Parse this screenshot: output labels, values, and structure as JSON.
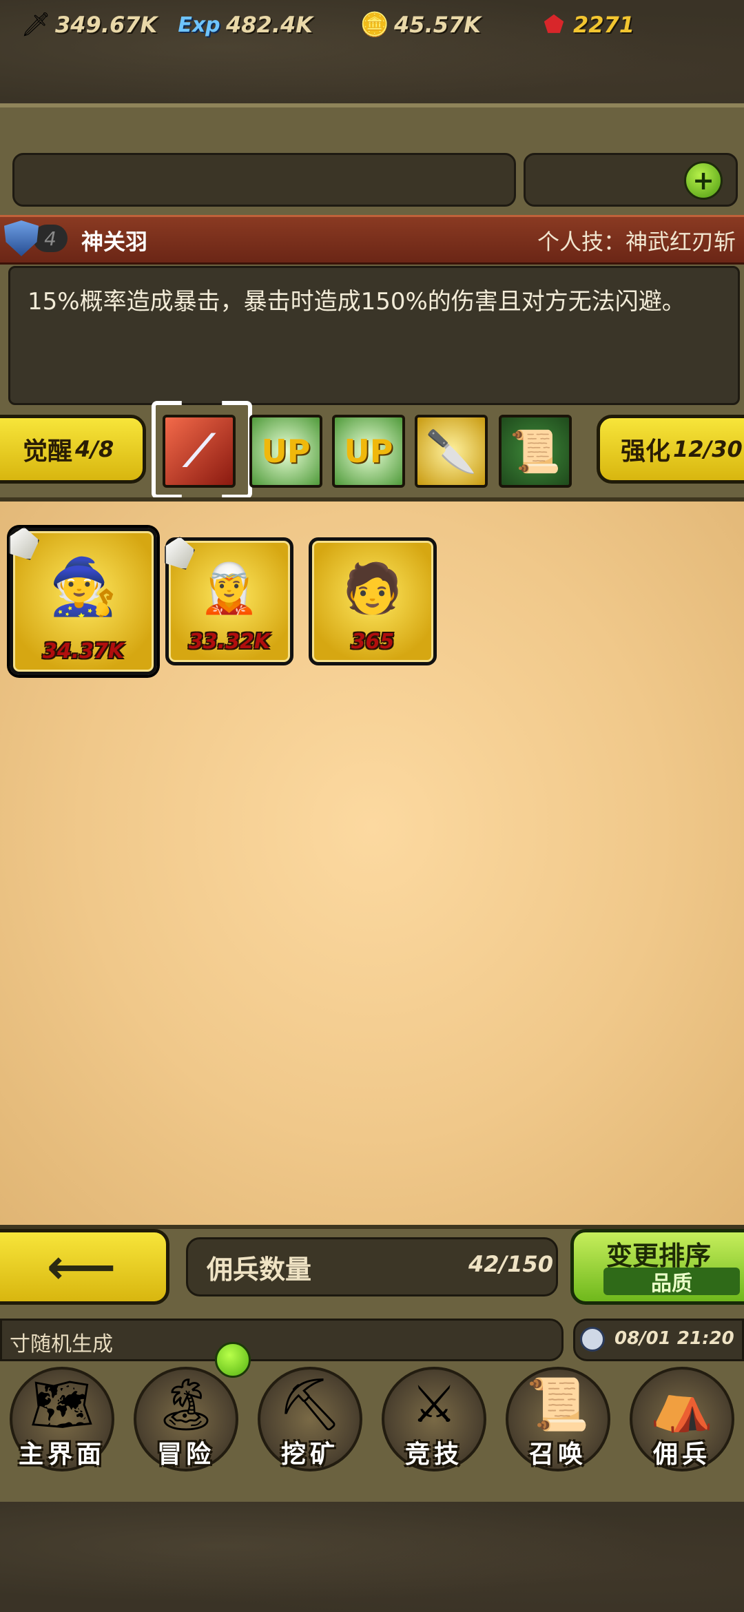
{
  "resources": {
    "attack": {
      "icon": "sword-icon",
      "value": "349.67K"
    },
    "exp": {
      "icon": "exp-icon",
      "label": "Exp",
      "value": "482.4K"
    },
    "gold": {
      "icon": "coin-icon",
      "value": "45.57K"
    },
    "gems": {
      "icon": "ruby-icon",
      "value": "2271"
    }
  },
  "hero": {
    "level": "4",
    "name": "神关羽",
    "skill_title": "个人技：神武红刃斩",
    "description": "15%概率造成暴击，暴击时造成150%的伤害且对方无法闪避。"
  },
  "awaken": {
    "label": "觉醒",
    "value": "4/8"
  },
  "enhance": {
    "label": "强化",
    "value": "12/30"
  },
  "skill_icons": [
    {
      "icon": "blade-slash-icon",
      "selected": true
    },
    {
      "icon": "crown-up-icon",
      "text": "UP"
    },
    {
      "icon": "crown-up-icon",
      "text": "UP"
    },
    {
      "icon": "glaive-icon"
    },
    {
      "icon": "scroll-bundle-icon"
    }
  ],
  "mercenaries": [
    {
      "name": "white-haired-elder",
      "power": "34.37K",
      "selected": true
    },
    {
      "name": "white-haired-warrior",
      "power": "33.32K"
    },
    {
      "name": "green-robed-hero",
      "power": "365"
    }
  ],
  "footer": {
    "count_label": "佣兵数量",
    "count_value": "42/150",
    "sort_title": "变更排序",
    "sort_mode": "品质"
  },
  "ticker": {
    "text": "寸随机生成",
    "time": "08/01 21:20"
  },
  "nav": [
    {
      "label": "主界面",
      "icon": "map-scroll-icon"
    },
    {
      "label": "冒险",
      "icon": "island-icon"
    },
    {
      "label": "挖矿",
      "icon": "pickaxe-icon"
    },
    {
      "label": "竞技",
      "icon": "crossed-swords-icon"
    },
    {
      "label": "召唤",
      "icon": "summon-scroll-icon"
    },
    {
      "label": "佣兵",
      "icon": "tent-icon"
    }
  ],
  "colors": {
    "accent_yellow": "#f7e53a",
    "accent_green": "#8ccf2a",
    "title_red": "#7a2e1a",
    "panel_parchment": "#f6d293"
  }
}
